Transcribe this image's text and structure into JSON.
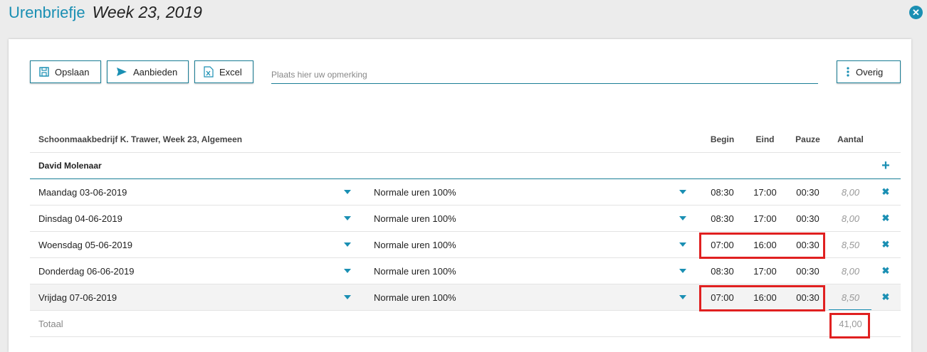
{
  "header": {
    "app_title": "Urenbriefje",
    "week_title": "Week 23, 2019"
  },
  "toolbar": {
    "save_label": "Opslaan",
    "offer_label": "Aanbieden",
    "excel_label": "Excel",
    "remark_placeholder": "Plaats hier uw opmerking",
    "more_label": "Overig"
  },
  "table": {
    "group_title": "Schoonmaakbedrijf K. Trawer, Week 23, Algemeen",
    "columns": {
      "begin": "Begin",
      "eind": "Eind",
      "pauze": "Pauze",
      "aantal": "Aantal"
    },
    "employee": "David Molenaar",
    "rows": [
      {
        "day": "Maandag 03-06-2019",
        "type": "Normale uren 100%",
        "begin": "08:30",
        "eind": "17:00",
        "pauze": "00:30",
        "aantal": "8,00"
      },
      {
        "day": "Dinsdag 04-06-2019",
        "type": "Normale uren 100%",
        "begin": "08:30",
        "eind": "17:00",
        "pauze": "00:30",
        "aantal": "8,00"
      },
      {
        "day": "Woensdag 05-06-2019",
        "type": "Normale uren 100%",
        "begin": "07:00",
        "eind": "16:00",
        "pauze": "00:30",
        "aantal": "8,50"
      },
      {
        "day": "Donderdag 06-06-2019",
        "type": "Normale uren 100%",
        "begin": "08:30",
        "eind": "17:00",
        "pauze": "00:30",
        "aantal": "8,00"
      },
      {
        "day": "Vrijdag 07-06-2019",
        "type": "Normale uren 100%",
        "begin": "07:00",
        "eind": "16:00",
        "pauze": "00:30",
        "aantal": "8,50"
      }
    ],
    "total_label": "Totaal",
    "total_value": "41,00"
  },
  "colors": {
    "accent": "#1a8fb3",
    "highlight": "#e02020"
  }
}
